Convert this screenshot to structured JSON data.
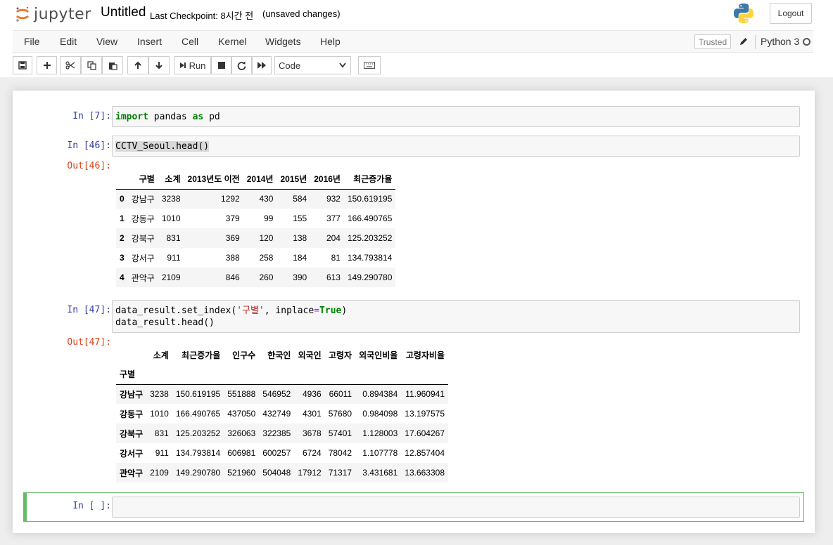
{
  "header": {
    "logo_text": "jupyter",
    "notebook_name": "Untitled",
    "checkpoint": "Last Checkpoint: 8시간 전",
    "autosave": "(unsaved changes)",
    "logout_label": "Logout"
  },
  "menubar": {
    "items": [
      "File",
      "Edit",
      "View",
      "Insert",
      "Cell",
      "Kernel",
      "Widgets",
      "Help"
    ],
    "trusted_label": "Trusted",
    "kernel_name": "Python 3"
  },
  "toolbar": {
    "run_label": "Run",
    "cell_type": "Code"
  },
  "cells": {
    "c1": {
      "prompt": "In [7]:"
    },
    "c2": {
      "prompt": "In [46]:",
      "code": "CCTV_Seoul.head()",
      "out_prompt": "Out[46]:"
    },
    "c3": {
      "prompt": "In [47]:",
      "code_line1_a": "data_result.set_index(",
      "code_line1_str": "'구별'",
      "code_line1_b": ", inplace",
      "code_line1_eq": "=",
      "code_line1_true": "True",
      "code_line1_c": ")",
      "code_line2": "data_result.head()",
      "out_prompt": "Out[47]:"
    },
    "c4": {
      "prompt": "In [ ]:"
    }
  },
  "code_tokens": {
    "import": "import",
    "pandas": " pandas ",
    "as": "as",
    "pd": " pd"
  },
  "df1": {
    "columns": [
      "",
      "구별",
      "소계",
      "2013년도 이전",
      "2014년",
      "2015년",
      "2016년",
      "최근증가율"
    ],
    "rows": [
      [
        "0",
        "강남구",
        "3238",
        "1292",
        "430",
        "584",
        "932",
        "150.619195"
      ],
      [
        "1",
        "강동구",
        "1010",
        "379",
        "99",
        "155",
        "377",
        "166.490765"
      ],
      [
        "2",
        "강북구",
        "831",
        "369",
        "120",
        "138",
        "204",
        "125.203252"
      ],
      [
        "3",
        "강서구",
        "911",
        "388",
        "258",
        "184",
        "81",
        "134.793814"
      ],
      [
        "4",
        "관악구",
        "2109",
        "846",
        "260",
        "390",
        "613",
        "149.290780"
      ]
    ]
  },
  "df2": {
    "columns": [
      "",
      "소계",
      "최근증가율",
      "인구수",
      "한국인",
      "외국인",
      "고령자",
      "외국인비율",
      "고령자비율"
    ],
    "index_name": "구별",
    "rows": [
      [
        "강남구",
        "3238",
        "150.619195",
        "551888",
        "546952",
        "4936",
        "66011",
        "0.894384",
        "11.960941"
      ],
      [
        "강동구",
        "1010",
        "166.490765",
        "437050",
        "432749",
        "4301",
        "57680",
        "0.984098",
        "13.197575"
      ],
      [
        "강북구",
        "831",
        "125.203252",
        "326063",
        "322385",
        "3678",
        "57401",
        "1.128003",
        "17.604267"
      ],
      [
        "강서구",
        "911",
        "134.793814",
        "606981",
        "600257",
        "6724",
        "78042",
        "1.107778",
        "12.857404"
      ],
      [
        "관악구",
        "2109",
        "149.290780",
        "521960",
        "504048",
        "17912",
        "71317",
        "3.431681",
        "13.663308"
      ]
    ]
  },
  "colors": {
    "in_prompt": "#303f9f",
    "out_prompt": "#d84315",
    "selected_border": "#66bb6a"
  }
}
